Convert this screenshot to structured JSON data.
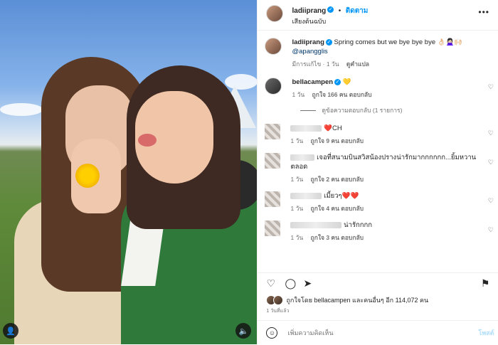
{
  "post": {
    "author": "ladiiprang",
    "follow_label": "ติดตาม",
    "audio_label": "เสียงต้นฉบับ",
    "more_icon": "•••",
    "caption": "Spring comes but we bye bye bye 👌🏻🙅🏻‍♀️🙌🏻",
    "caption_mention": "@apangglis",
    "caption_meta": {
      "edited": "มีการแก้ไข · 1 วัน",
      "translate": "ดูคำแปล"
    }
  },
  "comments": [
    {
      "user": "bellacampen",
      "verified": true,
      "text": "💛",
      "time": "1 วัน",
      "likes": "ถูกใจ 166 คน",
      "reply": "ตอบกลับ",
      "view_replies": "ดูข้อความตอบกลับ (1 รายการ)"
    },
    {
      "user": "",
      "text": "❤️CH",
      "time": "1 วัน",
      "likes": "ถูกใจ 9 คน",
      "reply": "ตอบกลับ"
    },
    {
      "user": "",
      "text": "เจอที่สนามบินสวิสน้องปรางน่ารักมากกกกกก...ยิ้มหวานตลอด",
      "time": "1 วัน",
      "likes": "ถูกใจ 2 คน",
      "reply": "ตอบกลับ"
    },
    {
      "user": "",
      "text": "เมี้ยวๆ❤️❤️",
      "time": "1 วัน",
      "likes": "ถูกใจ 4 คน",
      "reply": "ตอบกลับ"
    },
    {
      "user": "",
      "text": "น่ารักกกก",
      "time": "1 วัน",
      "likes": "ถูกใจ 3 คน",
      "reply": "ตอบกลับ"
    }
  ],
  "liked_by": "ถูกใจโดย bellacampen และคนอื่นๆ อีก 114,072 คน",
  "post_time": "1 วันที่แล้ว",
  "comment_input": {
    "placeholder": "เพิ่มความคิดเห็น",
    "post_label": "โพสต์"
  },
  "icons": {
    "heart": "♡",
    "comment": "◯",
    "share": "➤",
    "save": "⚑",
    "emoji": "☺",
    "user_tag": "👤",
    "audio": "🔈"
  },
  "colors": {
    "accent": "#0095f6",
    "text": "#262626",
    "muted": "#737373",
    "jacket": "#2f7a3a"
  }
}
